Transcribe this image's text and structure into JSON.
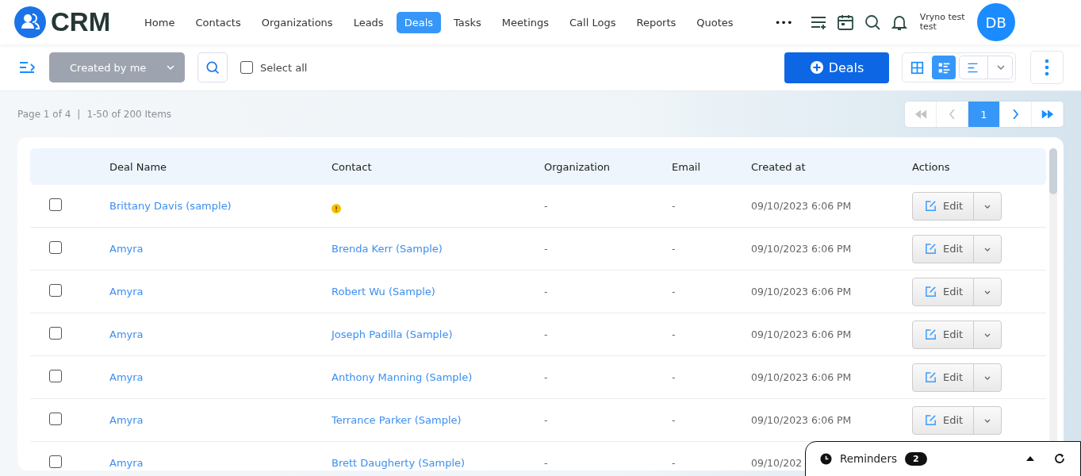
{
  "brand": "CRM",
  "nav": [
    {
      "label": "Home",
      "selected": false
    },
    {
      "label": "Contacts",
      "selected": false
    },
    {
      "label": "Organizations",
      "selected": false
    },
    {
      "label": "Leads",
      "selected": false
    },
    {
      "label": "Deals",
      "selected": true
    },
    {
      "label": "Tasks",
      "selected": false
    },
    {
      "label": "Meetings",
      "selected": false
    },
    {
      "label": "Call Logs",
      "selected": false
    },
    {
      "label": "Reports",
      "selected": false
    },
    {
      "label": "Quotes",
      "selected": false
    }
  ],
  "more": "•••",
  "user": {
    "name": "Vryno test test",
    "initials": "DB"
  },
  "toolbar": {
    "filter": "Created by me",
    "select_all": {
      "label": "Select all",
      "checked": false
    },
    "add_button": "Deals",
    "views": [
      {
        "kind": "grid",
        "selected": false
      },
      {
        "kind": "list",
        "selected": true
      }
    ]
  },
  "pager": {
    "summary": "Page 1 of 4",
    "separator": "|",
    "range": "1-50 of 200 Items",
    "current": "1"
  },
  "table": {
    "columns": [
      "Deal Name",
      "Contact",
      "Organization",
      "Email",
      "Created at",
      "Actions"
    ],
    "rows": [
      {
        "deal": "Brittany Davis (sample)",
        "warning": true,
        "organization": "-",
        "email": "-",
        "created": "09/10/2023 6:06 PM",
        "action": "Edit",
        "selected": false
      },
      {
        "deal": "Amyra",
        "contact": "Brenda Kerr (Sample)",
        "warning": false,
        "organization": "-",
        "email": "-",
        "created": "09/10/2023 6:06 PM",
        "action": "Edit",
        "selected": false
      },
      {
        "deal": "Amyra",
        "contact": "Robert Wu (Sample)",
        "warning": false,
        "organization": "-",
        "email": "-",
        "created": "09/10/2023 6:06 PM",
        "action": "Edit",
        "selected": false
      },
      {
        "deal": "Amyra",
        "contact": "Joseph Padilla (Sample)",
        "warning": false,
        "organization": "-",
        "email": "-",
        "created": "09/10/2023 6:06 PM",
        "action": "Edit",
        "selected": false
      },
      {
        "deal": "Amyra",
        "contact": "Anthony Manning (Sample)",
        "warning": false,
        "organization": "-",
        "email": "-",
        "created": "09/10/2023 6:06 PM",
        "action": "Edit",
        "selected": false
      },
      {
        "deal": "Amyra",
        "contact": "Terrance Parker (Sample)",
        "warning": false,
        "organization": "-",
        "email": "-",
        "created": "09/10/2023 6:06 PM",
        "action": "Edit",
        "selected": false
      },
      {
        "deal": "Amyra",
        "contact": "Brett Daugherty (Sample)",
        "warning": false,
        "organization": "-",
        "email": "-",
        "created": "09/10/202",
        "selected": false
      }
    ]
  },
  "reminders": {
    "label": "Reminders",
    "count": "2"
  }
}
